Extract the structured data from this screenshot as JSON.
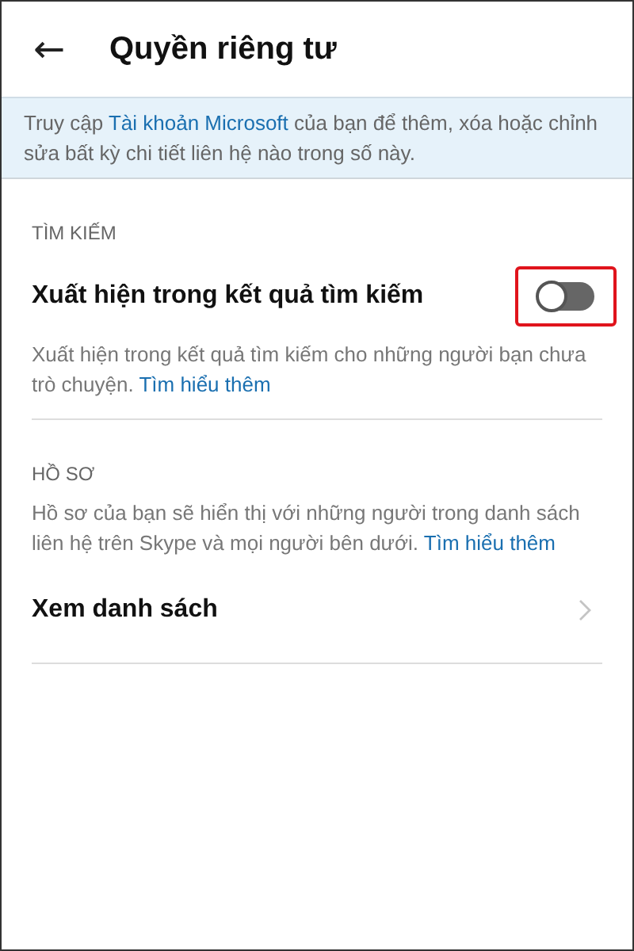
{
  "header": {
    "back_icon": "←",
    "title": "Quyền riêng tư"
  },
  "banner": {
    "before": "Truy cập ",
    "link": "Tài khoản Microsoft",
    "after": " của bạn để thêm, xóa hoặc chỉnh sửa bất kỳ chi tiết liên hệ nào trong số này."
  },
  "sections": [
    {
      "heading": "TÌM KIẾM",
      "kind": "toggle",
      "title": "Xuất hiện trong kết quả tìm kiếm",
      "annotated": true,
      "toggle": {
        "on": false
      },
      "description": "Xuất hiện trong kết quả tìm kiếm cho những người bạn chưa trò chuyện.",
      "link": "Tìm hiểu thêm"
    },
    {
      "heading": "HỒ SƠ",
      "kind": "nav",
      "description": "Hồ sơ của bạn sẽ hiển thị với những người trong danh sách liên hệ trên Skype và mọi người bên dưới.",
      "link": "Tìm hiểu thêm",
      "title": "Xem danh sách"
    }
  ]
}
